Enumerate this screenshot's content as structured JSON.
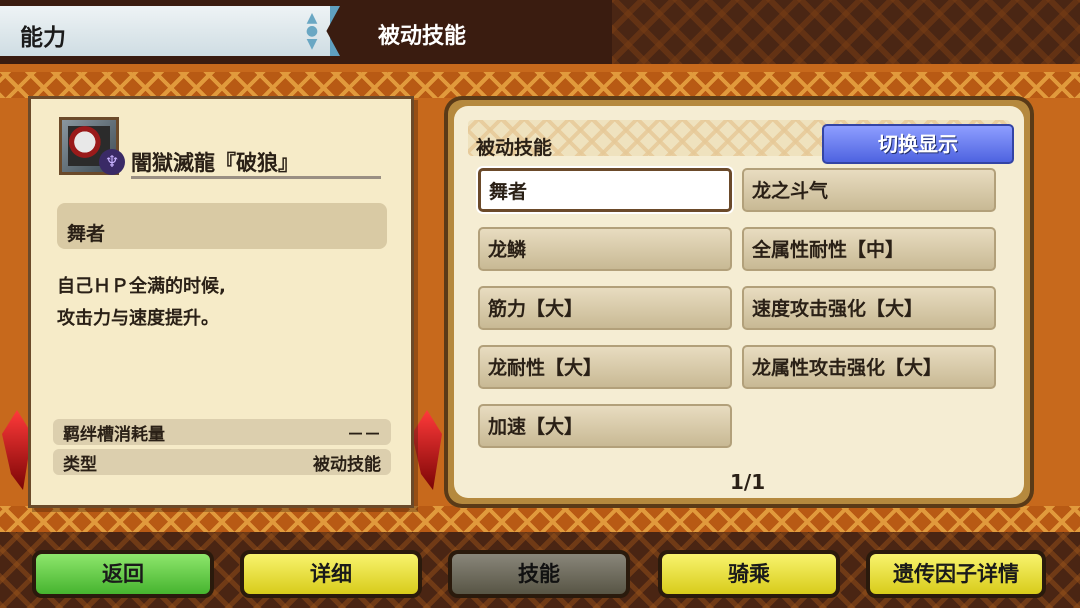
{
  "header": {
    "section_title": "能力",
    "page_heading": "被动技能"
  },
  "monster": {
    "name": "闇獄滅龍『破狼』",
    "portrait_icon": "zinogre-portrait-icon",
    "element_icon": "dragon-element-icon"
  },
  "skill_detail": {
    "name": "舞者",
    "description_line1": "自己ＨＰ全满的时候,",
    "description_line2": "攻击力与速度提升。",
    "stats": [
      {
        "label": "羁绊槽消耗量",
        "value": "－－"
      },
      {
        "label": "类型",
        "value": "被动技能"
      }
    ]
  },
  "skill_panel": {
    "title": "被动技能",
    "toggle_label": "切换显示",
    "skills": [
      {
        "label": "舞者",
        "selected": true
      },
      {
        "label": "龙之斗气",
        "selected": false
      },
      {
        "label": "龙鳞",
        "selected": false
      },
      {
        "label": "全属性耐性【中】",
        "selected": false
      },
      {
        "label": "筋力【大】",
        "selected": false
      },
      {
        "label": "速度攻击强化【大】",
        "selected": false
      },
      {
        "label": "龙耐性【大】",
        "selected": false
      },
      {
        "label": "龙属性攻击强化【大】",
        "selected": false
      },
      {
        "label": "加速【大】",
        "selected": false
      }
    ],
    "page": "1/1"
  },
  "footer": {
    "back": "返回",
    "details": "详细",
    "skills": "技能",
    "riding": "骑乘",
    "gene_details": "遗传因子详情"
  },
  "colors": {
    "accent_blue": "#4e63e0",
    "back_green": "#46b42f",
    "button_yellow": "#d8cc1a",
    "active_dim": "#585545"
  }
}
